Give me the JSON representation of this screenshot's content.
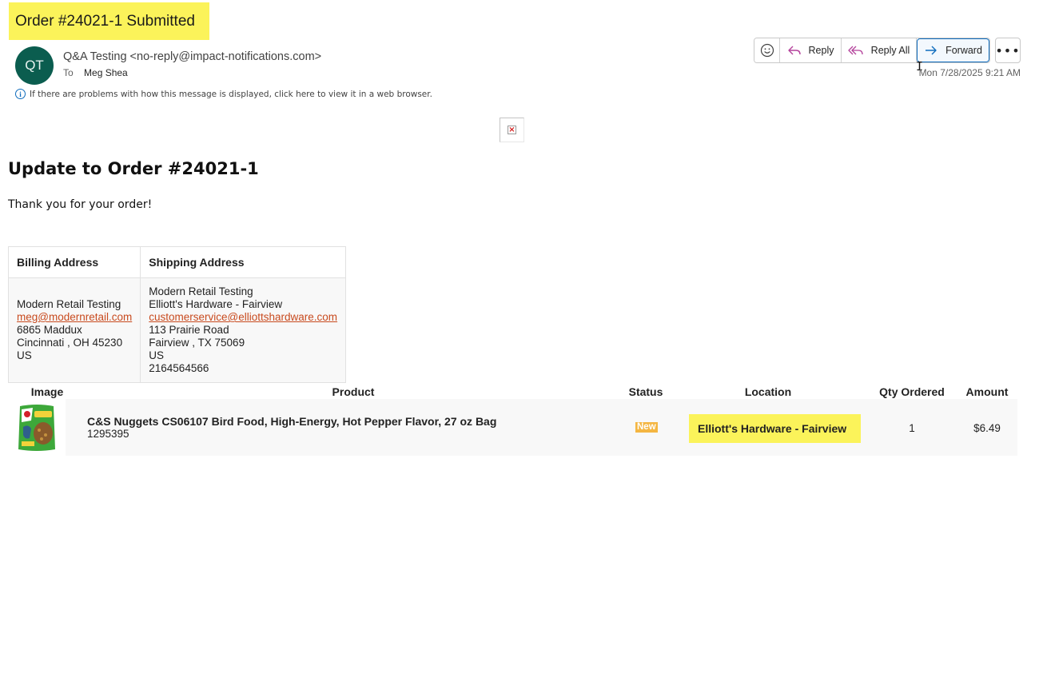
{
  "subject": "Order #24021-1 Submitted",
  "header": {
    "avatar_initials": "QT",
    "sender": "Q&A Testing <no-reply@impact-notifications.com>",
    "to_label": "To",
    "to_name": "Meg Shea",
    "timestamp": "Mon 7/28/2025 9:21 AM",
    "info_text": "If there are problems with how this message is displayed, click here to view it in a web browser."
  },
  "actions": {
    "reply": "Reply",
    "reply_all": "Reply All",
    "forward": "Forward"
  },
  "email": {
    "heading": "Update to Order #24021-1",
    "thanks": "Thank you for your order!",
    "billing": {
      "header": "Billing Address",
      "name": "Modern Retail Testing",
      "email": "meg@modernretail.com",
      "street": "6865 Maddux",
      "city_line": "Cincinnati , OH 45230",
      "country": "US"
    },
    "shipping": {
      "header": "Shipping Address",
      "name": "Modern Retail Testing",
      "company": "Elliott's Hardware - Fairview",
      "email": "customerservice@elliottshardware.com",
      "street": "113 Prairie Road",
      "city_line": "Fairview , TX 75069",
      "country": "US",
      "phone": "2164564566"
    },
    "items": {
      "columns": [
        "Image",
        "Product",
        "Status",
        "Location",
        "Qty Ordered",
        "Amount"
      ],
      "rows": [
        {
          "product": "C&S Nuggets CS06107 Bird Food, High-Energy, Hot Pepper Flavor, 27 oz Bag",
          "sku": "1295395",
          "status": "New",
          "location": "Elliott's Hardware - Fairview",
          "qty": "1",
          "amount": "$6.49"
        }
      ]
    }
  },
  "colors": {
    "highlight": "#fbf35a",
    "avatar": "#0b5d4f",
    "link": "#c84a1e",
    "status_badge": "#f4b642",
    "accent": "#0f6cbd"
  }
}
